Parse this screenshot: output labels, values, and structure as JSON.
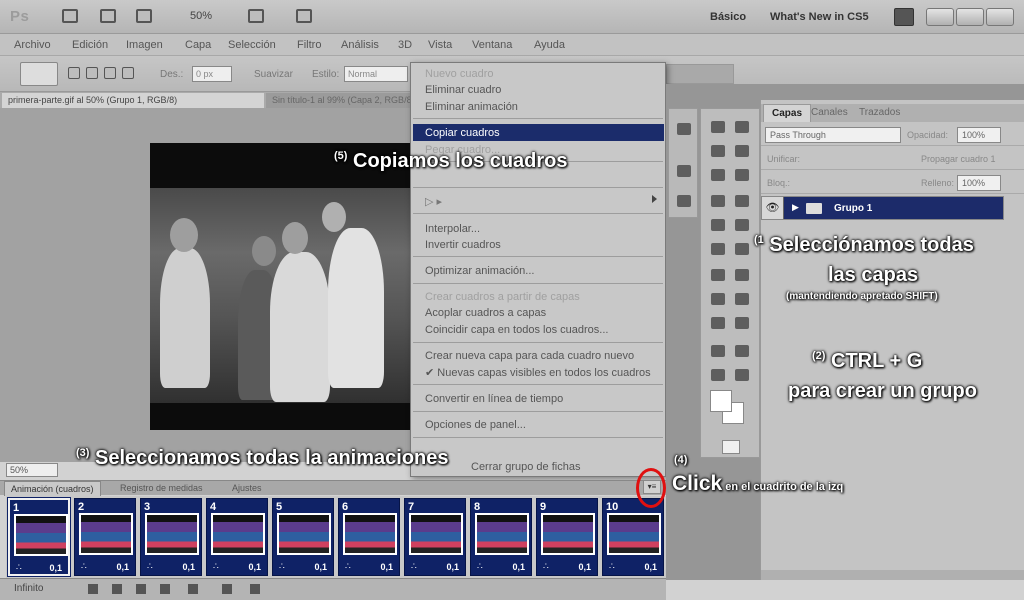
{
  "app": {
    "logo": "Ps",
    "zoom": "50%",
    "workspace_basico": "Básico",
    "workspace_whats_new": "What's New in CS5"
  },
  "menubar": [
    "Archivo",
    "Edición",
    "Imagen",
    "Capa",
    "Selección",
    "Filtro",
    "Análisis",
    "3D",
    "Vista",
    "Ventana",
    "Ayuda"
  ],
  "options": {
    "size_label": "Des.:",
    "size_value": "0 px",
    "smooth_label": "Suavizar",
    "style_label": "Estilo:",
    "style_value": "Normal"
  },
  "doc_tabs": [
    "primera-parte.gif al 50% (Grupo 1, RGB/8)",
    "Sin título-1 al 99% (Capa 2, RGB/8)"
  ],
  "context_menu": {
    "items": [
      {
        "label": "Nuevo cuadro",
        "faded": true
      },
      {
        "label": "Eliminar cuadro",
        "faded": false
      },
      {
        "label": "Eliminar animación",
        "faded": false
      },
      {
        "label": "Copiar cuadros",
        "faded": false,
        "selected": true
      },
      {
        "label": "Pegar cuadro...",
        "faded": true
      },
      {
        "label": "Interpolar...",
        "faded": false
      },
      {
        "label": "Invertir cuadros",
        "faded": false
      },
      {
        "label": "Optimizar animación...",
        "faded": false
      },
      {
        "label": "Crear cuadros a partir de capas",
        "faded": true
      },
      {
        "label": "Acoplar cuadros a capas",
        "faded": false
      },
      {
        "label": "Coincidir capa en todos los cuadros...",
        "faded": false
      },
      {
        "label": "Crear nueva capa para cada cuadro nuevo",
        "faded": false
      },
      {
        "label": "Nuevas capas visibles en todos los cuadros",
        "faded": false
      },
      {
        "label": "Convertir en línea de tiempo",
        "faded": false
      },
      {
        "label": "Opciones de panel...",
        "faded": false
      },
      {
        "label": "Cerrar grupo de fichas",
        "faded": false
      }
    ]
  },
  "layers_panel": {
    "tabs": [
      "Capas",
      "Canales",
      "Trazados"
    ],
    "blend_mode": "Pass Through",
    "opacity_label": "Opacidad:",
    "opacity_value": "100%",
    "unify_label": "Unificar:",
    "propagate_label": "Propagar cuadro 1",
    "lock_label": "Bloq.:",
    "fill_label": "Relleno:",
    "fill_value": "100%",
    "group_name": "Grupo 1",
    "eye_icon": "eye-icon"
  },
  "animation_panel": {
    "zoom_value": "50%",
    "tabs": [
      "Animación (cuadros)",
      "Registro de medidas",
      "Ajustes"
    ],
    "loop_value": "Infinito",
    "frames": [
      {
        "num": "1",
        "delay": "0,1"
      },
      {
        "num": "2",
        "delay": "0,1"
      },
      {
        "num": "3",
        "delay": "0,1"
      },
      {
        "num": "4",
        "delay": "0,1"
      },
      {
        "num": "5",
        "delay": "0,1"
      },
      {
        "num": "6",
        "delay": "0,1"
      },
      {
        "num": "7",
        "delay": "0,1"
      },
      {
        "num": "8",
        "delay": "0,1"
      },
      {
        "num": "9",
        "delay": "0,1"
      },
      {
        "num": "10",
        "delay": "0,1"
      }
    ]
  },
  "annotations": {
    "a1_num": "(1",
    "a1_line1": "Selecciónamos todas",
    "a1_line2": "las capas",
    "a1_line3": "(mantendiendo apretado SHIFT)",
    "a2_num": "(2)",
    "a2_line1": "CTRL + G",
    "a2_line2": "para crear un grupo",
    "a3_num": "(3)",
    "a3_text": "Seleccionamos todas la animaciones",
    "a4_num": "(4)",
    "a4_big": "Click",
    "a4_small": "en el cuadrito de la izq",
    "a5_num": "(5)",
    "a5_text": "Copiamos los cuadros"
  },
  "colors": {
    "highlight": "#1b2c6b",
    "frame_bg": "#0f2266",
    "red_circle": "#e01010"
  }
}
